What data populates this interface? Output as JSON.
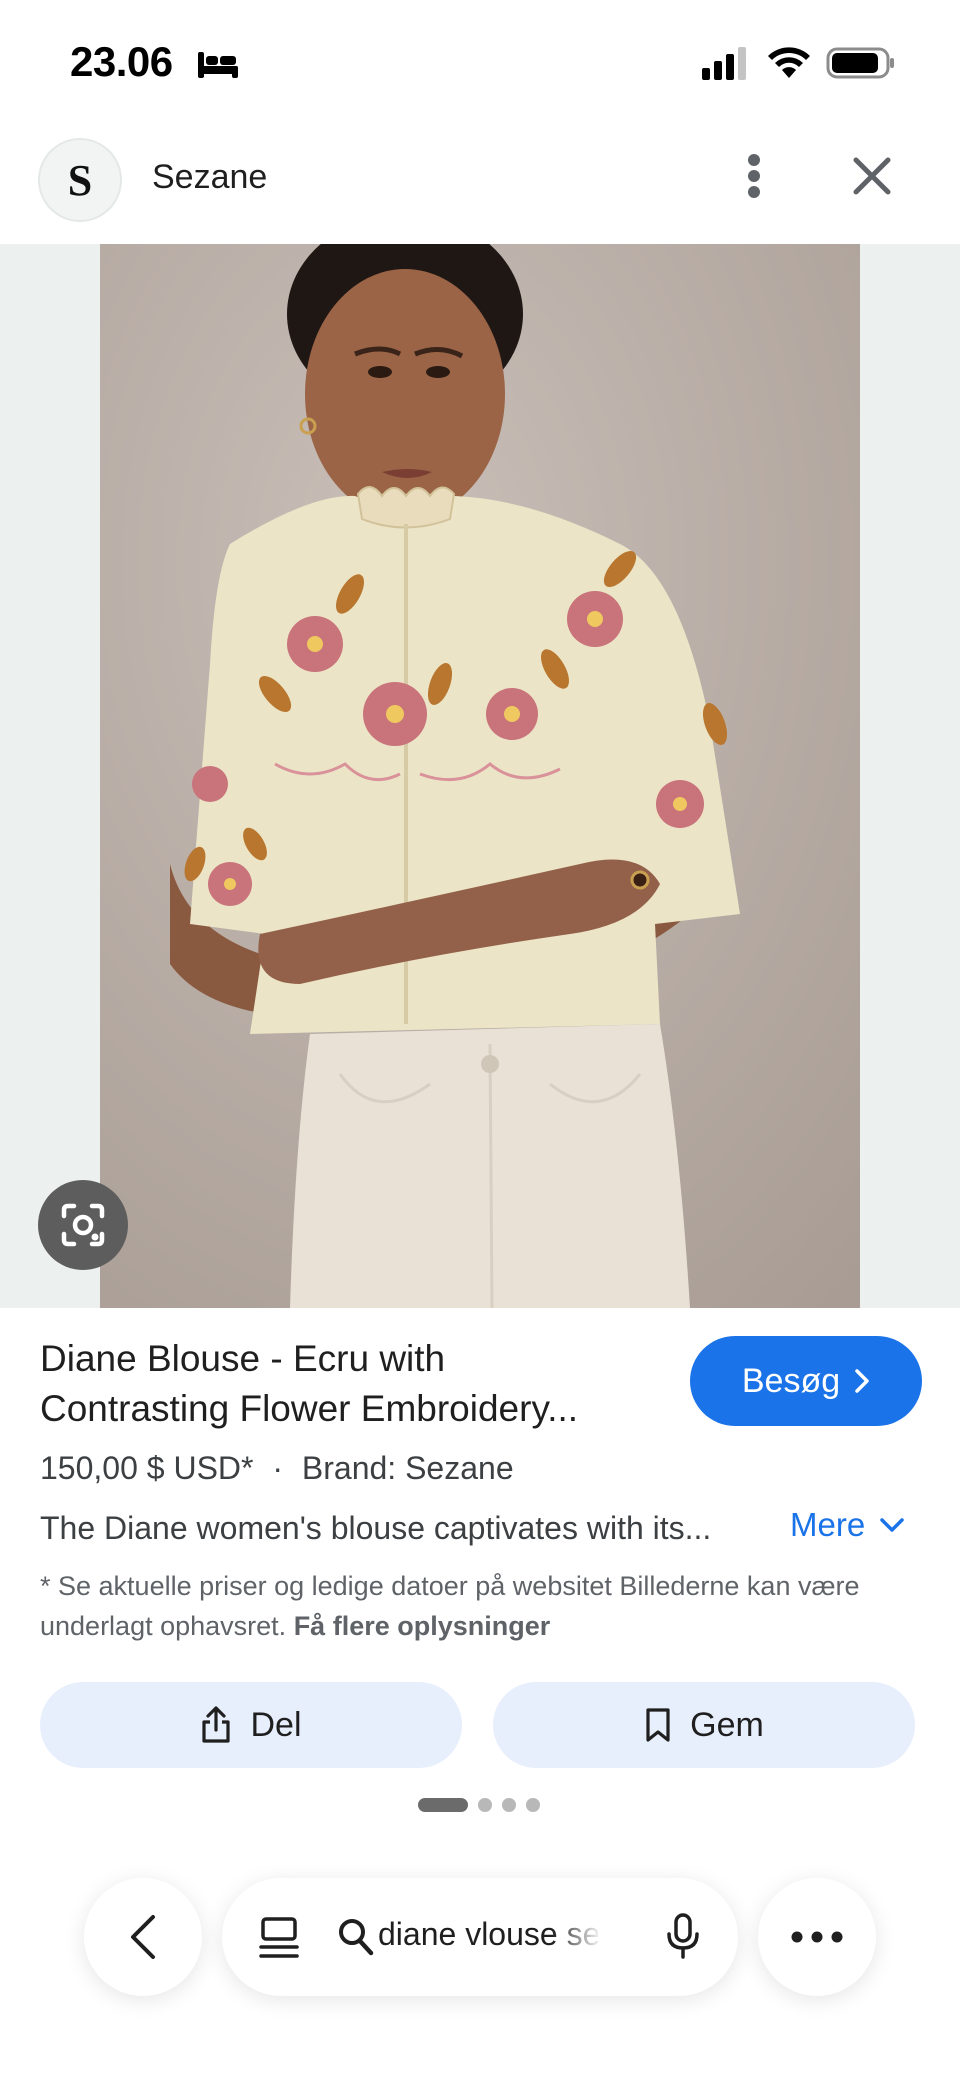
{
  "status_bar": {
    "time": "23.06"
  },
  "header": {
    "logo_letter": "S",
    "site_name": "Sezane"
  },
  "product": {
    "title_line1": "Diane Blouse - Ecru with",
    "title_line2": "Contrasting Flower Embroidery...",
    "visit_label": "Besøg",
    "price": "150,00 $ USD*",
    "separator": "·",
    "brand": "Brand: Sezane",
    "description": "The Diane women's blouse captivates with its...",
    "more_label": "Mere",
    "disclaimer_text": "* Se aktuelle priser og ledige datoer på websitet Billederne kan være underlagt ophavsret.",
    "disclaimer_link": "Få flere oplysninger"
  },
  "actions": {
    "share_label": "Del",
    "save_label": "Gem"
  },
  "pager": {
    "count": 4,
    "active_index": 0
  },
  "toolbar": {
    "search_query": "diane vlouse sez"
  },
  "colors": {
    "accent": "#1a73e8",
    "action_bg": "#e8effc",
    "image_bg": "#ecf0ef"
  },
  "icons": [
    "bed-icon",
    "signal-icon",
    "wifi-icon",
    "battery-icon",
    "more-vert-icon",
    "close-icon",
    "lens-icon",
    "chevron-right-icon",
    "chevron-down-icon",
    "share-icon",
    "bookmark-icon",
    "back-icon",
    "tabs-icon",
    "search-icon",
    "mic-icon",
    "more-horiz-icon"
  ]
}
